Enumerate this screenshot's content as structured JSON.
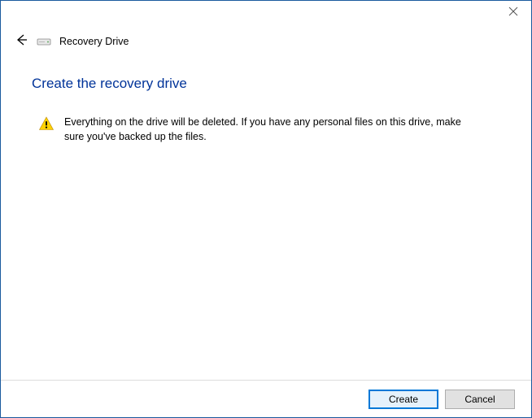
{
  "titlebar": {
    "close_name": "close"
  },
  "header": {
    "back_name": "back",
    "drive_name": "drive",
    "title": "Recovery Drive"
  },
  "main": {
    "heading": "Create the recovery drive",
    "warning_name": "warning",
    "warning_text": "Everything on the drive will be deleted. If you have any personal files on this drive, make sure you've backed up the files."
  },
  "footer": {
    "primary_label": "Create",
    "cancel_label": "Cancel"
  }
}
